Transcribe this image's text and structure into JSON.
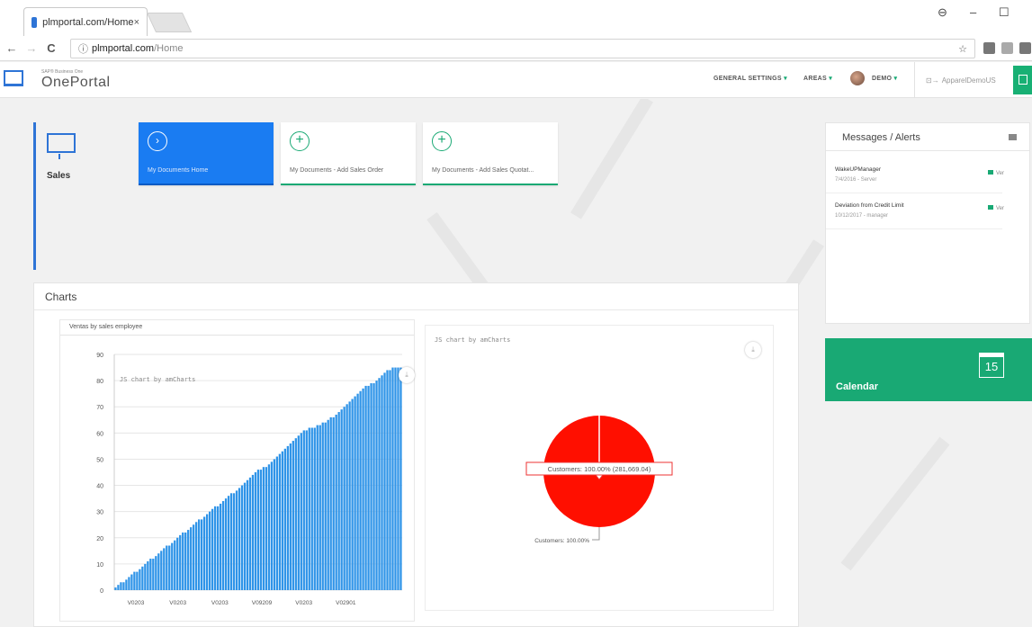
{
  "browser": {
    "tab_title": "plmportal.com/Home",
    "tab_close": "×",
    "url_host": "plmportal.com",
    "url_path": "/Home",
    "url_info": "ⓘ",
    "back": "←",
    "forward": "→",
    "reload": "C",
    "star": "☆",
    "profile": "⊖",
    "minimize": "–",
    "maximize": "☐"
  },
  "header": {
    "logo_small": "SAP® Business One",
    "logo_text": "OnePortal",
    "general_settings": "GENERAL SETTINGS",
    "areas": "AREAS",
    "user": "DEMO",
    "company": "ApparelDemoUS",
    "company_icon": "⊡→",
    "caret": "▾"
  },
  "sales": {
    "label": "Sales"
  },
  "tiles": [
    {
      "label": "My Documents Home",
      "icon": "›"
    },
    {
      "label": "My Documents - Add Sales Order",
      "icon": "+"
    },
    {
      "label": "My Documents - Add Sales Quotat...",
      "icon": "+"
    }
  ],
  "charts_section": {
    "title": "Charts",
    "bar_title": "Ventas by sales employee",
    "credit": "JS chart by amCharts",
    "download_icon": "⤓"
  },
  "messages": {
    "title": "Messages / Alerts",
    "items": [
      {
        "title": "WakeUPManager",
        "meta": "7/4/2016 - Server",
        "action": "Ver"
      },
      {
        "title": "Deviation from Credit Limit",
        "meta": "10/12/2017 - manager",
        "action": "Ver"
      }
    ]
  },
  "calendar": {
    "label": "Calendar",
    "day": "15"
  },
  "colors": {
    "accent_blue": "#1a7cf2",
    "accent_green": "#19a974",
    "bar_blue": "#2f94e8",
    "pie_red": "#ff0f00"
  },
  "chart_data": [
    {
      "type": "bar",
      "title": "Ventas by sales employee",
      "ylim": [
        0,
        90
      ],
      "yticks": [
        0,
        10,
        20,
        30,
        40,
        50,
        60,
        70,
        80,
        90
      ],
      "xtick_labels": [
        "V0203",
        "V0203",
        "V0203",
        "V09209",
        "V0203",
        "V02901"
      ],
      "grid": true,
      "series": [
        {
          "values": [
            1,
            2,
            3,
            3,
            4,
            5,
            6,
            7,
            7,
            8,
            9,
            10,
            11,
            12,
            12,
            13,
            14,
            15,
            16,
            17,
            17,
            18,
            19,
            20,
            21,
            22,
            22,
            23,
            24,
            25,
            26,
            27,
            27,
            28,
            29,
            30,
            31,
            32,
            32,
            33,
            34,
            35,
            36,
            37,
            37,
            38,
            39,
            40,
            41,
            42,
            43,
            44,
            45,
            46,
            46,
            47,
            47,
            48,
            49,
            50,
            51,
            52,
            53,
            54,
            55,
            56,
            57,
            58,
            59,
            60,
            61,
            61,
            62,
            62,
            62,
            63,
            63,
            64,
            64,
            65,
            66,
            66,
            67,
            68,
            69,
            70,
            71,
            72,
            73,
            74,
            75,
            76,
            77,
            78,
            78,
            79,
            79,
            80,
            81,
            82,
            83,
            84,
            84,
            85,
            85,
            85,
            85
          ]
        }
      ]
    },
    {
      "type": "pie",
      "slices": [
        {
          "label": "Customers",
          "percent": 100.0,
          "value": 281669.04
        }
      ],
      "balloon": "Customers: 100.00% (281,669.04)",
      "slice_label": "Customers: 100.00%"
    }
  ]
}
